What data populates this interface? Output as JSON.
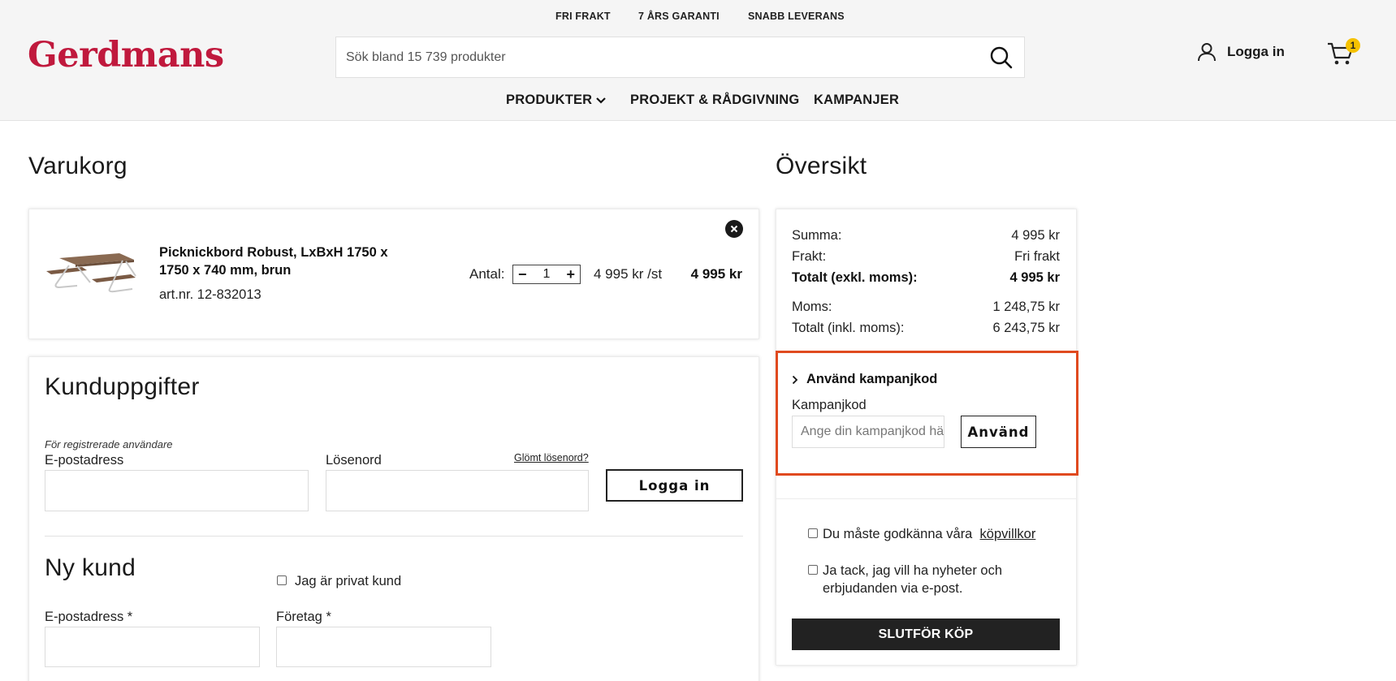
{
  "header": {
    "usps": [
      "FRI FRAKT",
      "7 ÅRS GARANTI",
      "SNABB LEVERANS"
    ],
    "logo": "Gerdmans",
    "search_placeholder": "Sök bland 15 739 produkter",
    "login_label": "Logga in",
    "cart_count": "1",
    "nav": {
      "products": "PRODUKTER",
      "projects": "PROJEKT & RÅDGIVNING",
      "campaigns": "KAMPANJER"
    }
  },
  "cart": {
    "title": "Varukorg",
    "item": {
      "name": "Picknickbord Robust, LxBxH 1750 x 1750 x 740 mm, brun",
      "art": "art.nr. 12-832013",
      "qty_label": "Antal:",
      "qty": "1",
      "unit_price": "4 995 kr /st",
      "total": "4 995 kr"
    }
  },
  "customer": {
    "title": "Kunduppgifter",
    "registered_note": "För registrerade användare",
    "email_label": "E-postadress",
    "password_label": "Lösenord",
    "forgot": "Glömt lösenord?",
    "login_button": "Logga in",
    "new_title": "Ny kund",
    "private_label": "Jag är privat kund",
    "new_email_label": "E-postadress *",
    "company_label": "Företag *"
  },
  "overview": {
    "title": "Översikt",
    "rows": [
      {
        "label": "Summa:",
        "value": "4 995 kr"
      },
      {
        "label": "Frakt:",
        "value": "Fri frakt"
      },
      {
        "label": "Totalt (exkl. moms):",
        "value": "4 995 kr"
      },
      {
        "label": "Moms:",
        "value": "1 248,75 kr"
      },
      {
        "label": "Totalt (inkl. moms):",
        "value": "6 243,75 kr"
      }
    ],
    "campaign": {
      "toggle": "Använd kampanjkod",
      "label": "Kampanjkod",
      "placeholder": "Ange din kampanjkod här",
      "button": "Använd"
    },
    "terms_text": "Du måste godkänna våra",
    "terms_link": "köpvillkor",
    "newsletter_text": "Ja tack, jag vill ha nyheter och erbjudanden via e-post.",
    "checkout": "SLUTFÖR KÖP"
  },
  "colors": {
    "brand": "#c0193d",
    "highlight_border": "#e04a1f",
    "badge": "#f6c200",
    "checkout_bg": "#222222"
  }
}
